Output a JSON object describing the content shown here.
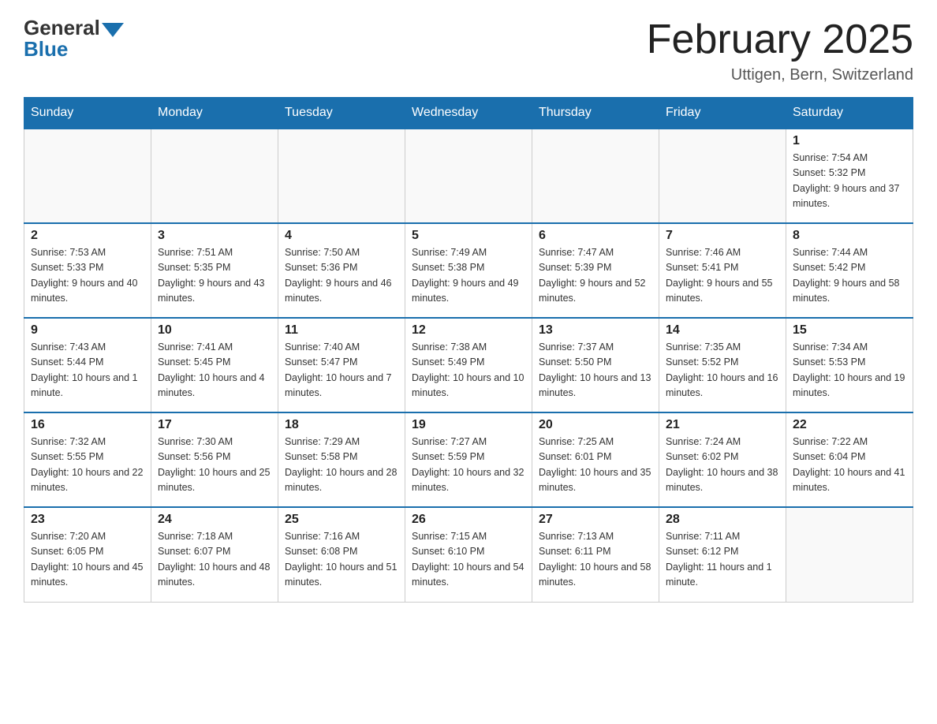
{
  "logo": {
    "general_text": "General",
    "blue_text": "Blue"
  },
  "header": {
    "title": "February 2025",
    "subtitle": "Uttigen, Bern, Switzerland"
  },
  "weekdays": [
    "Sunday",
    "Monday",
    "Tuesday",
    "Wednesday",
    "Thursday",
    "Friday",
    "Saturday"
  ],
  "weeks": [
    [
      {
        "day": "",
        "info": ""
      },
      {
        "day": "",
        "info": ""
      },
      {
        "day": "",
        "info": ""
      },
      {
        "day": "",
        "info": ""
      },
      {
        "day": "",
        "info": ""
      },
      {
        "day": "",
        "info": ""
      },
      {
        "day": "1",
        "info": "Sunrise: 7:54 AM\nSunset: 5:32 PM\nDaylight: 9 hours and 37 minutes."
      }
    ],
    [
      {
        "day": "2",
        "info": "Sunrise: 7:53 AM\nSunset: 5:33 PM\nDaylight: 9 hours and 40 minutes."
      },
      {
        "day": "3",
        "info": "Sunrise: 7:51 AM\nSunset: 5:35 PM\nDaylight: 9 hours and 43 minutes."
      },
      {
        "day": "4",
        "info": "Sunrise: 7:50 AM\nSunset: 5:36 PM\nDaylight: 9 hours and 46 minutes."
      },
      {
        "day": "5",
        "info": "Sunrise: 7:49 AM\nSunset: 5:38 PM\nDaylight: 9 hours and 49 minutes."
      },
      {
        "day": "6",
        "info": "Sunrise: 7:47 AM\nSunset: 5:39 PM\nDaylight: 9 hours and 52 minutes."
      },
      {
        "day": "7",
        "info": "Sunrise: 7:46 AM\nSunset: 5:41 PM\nDaylight: 9 hours and 55 minutes."
      },
      {
        "day": "8",
        "info": "Sunrise: 7:44 AM\nSunset: 5:42 PM\nDaylight: 9 hours and 58 minutes."
      }
    ],
    [
      {
        "day": "9",
        "info": "Sunrise: 7:43 AM\nSunset: 5:44 PM\nDaylight: 10 hours and 1 minute."
      },
      {
        "day": "10",
        "info": "Sunrise: 7:41 AM\nSunset: 5:45 PM\nDaylight: 10 hours and 4 minutes."
      },
      {
        "day": "11",
        "info": "Sunrise: 7:40 AM\nSunset: 5:47 PM\nDaylight: 10 hours and 7 minutes."
      },
      {
        "day": "12",
        "info": "Sunrise: 7:38 AM\nSunset: 5:49 PM\nDaylight: 10 hours and 10 minutes."
      },
      {
        "day": "13",
        "info": "Sunrise: 7:37 AM\nSunset: 5:50 PM\nDaylight: 10 hours and 13 minutes."
      },
      {
        "day": "14",
        "info": "Sunrise: 7:35 AM\nSunset: 5:52 PM\nDaylight: 10 hours and 16 minutes."
      },
      {
        "day": "15",
        "info": "Sunrise: 7:34 AM\nSunset: 5:53 PM\nDaylight: 10 hours and 19 minutes."
      }
    ],
    [
      {
        "day": "16",
        "info": "Sunrise: 7:32 AM\nSunset: 5:55 PM\nDaylight: 10 hours and 22 minutes."
      },
      {
        "day": "17",
        "info": "Sunrise: 7:30 AM\nSunset: 5:56 PM\nDaylight: 10 hours and 25 minutes."
      },
      {
        "day": "18",
        "info": "Sunrise: 7:29 AM\nSunset: 5:58 PM\nDaylight: 10 hours and 28 minutes."
      },
      {
        "day": "19",
        "info": "Sunrise: 7:27 AM\nSunset: 5:59 PM\nDaylight: 10 hours and 32 minutes."
      },
      {
        "day": "20",
        "info": "Sunrise: 7:25 AM\nSunset: 6:01 PM\nDaylight: 10 hours and 35 minutes."
      },
      {
        "day": "21",
        "info": "Sunrise: 7:24 AM\nSunset: 6:02 PM\nDaylight: 10 hours and 38 minutes."
      },
      {
        "day": "22",
        "info": "Sunrise: 7:22 AM\nSunset: 6:04 PM\nDaylight: 10 hours and 41 minutes."
      }
    ],
    [
      {
        "day": "23",
        "info": "Sunrise: 7:20 AM\nSunset: 6:05 PM\nDaylight: 10 hours and 45 minutes."
      },
      {
        "day": "24",
        "info": "Sunrise: 7:18 AM\nSunset: 6:07 PM\nDaylight: 10 hours and 48 minutes."
      },
      {
        "day": "25",
        "info": "Sunrise: 7:16 AM\nSunset: 6:08 PM\nDaylight: 10 hours and 51 minutes."
      },
      {
        "day": "26",
        "info": "Sunrise: 7:15 AM\nSunset: 6:10 PM\nDaylight: 10 hours and 54 minutes."
      },
      {
        "day": "27",
        "info": "Sunrise: 7:13 AM\nSunset: 6:11 PM\nDaylight: 10 hours and 58 minutes."
      },
      {
        "day": "28",
        "info": "Sunrise: 7:11 AM\nSunset: 6:12 PM\nDaylight: 11 hours and 1 minute."
      },
      {
        "day": "",
        "info": ""
      }
    ]
  ]
}
